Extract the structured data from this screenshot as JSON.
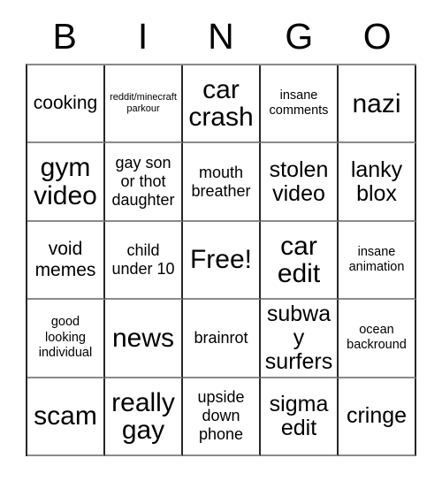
{
  "card": {
    "header_letters": [
      "B",
      "I",
      "N",
      "G",
      "O"
    ],
    "rows": [
      [
        {
          "text": "cooking",
          "size": "lg"
        },
        {
          "text": "reddit/minecraft parkour",
          "size": "xs"
        },
        {
          "text": "car crash",
          "size": "xxl"
        },
        {
          "text": "insane comments",
          "size": "sm"
        },
        {
          "text": "nazi",
          "size": "xxl"
        }
      ],
      [
        {
          "text": "gym video",
          "size": "xxl"
        },
        {
          "text": "gay son or thot daughter",
          "size": "md"
        },
        {
          "text": "mouth breather",
          "size": "md"
        },
        {
          "text": "stolen video",
          "size": "xl"
        },
        {
          "text": "lanky blox",
          "size": "xl"
        }
      ],
      [
        {
          "text": "void memes",
          "size": "lg"
        },
        {
          "text": "child under 10",
          "size": "md"
        },
        {
          "text": "Free!",
          "size": "xxl"
        },
        {
          "text": "car edit",
          "size": "xxl"
        },
        {
          "text": "insane animation",
          "size": "sm"
        }
      ],
      [
        {
          "text": "good looking individual",
          "size": "sm"
        },
        {
          "text": "news",
          "size": "xxl"
        },
        {
          "text": "brainrot",
          "size": "md"
        },
        {
          "text": "subway surfers",
          "size": "xl"
        },
        {
          "text": "ocean backround",
          "size": "sm"
        }
      ],
      [
        {
          "text": "scam",
          "size": "xxl"
        },
        {
          "text": "really gay",
          "size": "xxl"
        },
        {
          "text": "upside down phone",
          "size": "md"
        },
        {
          "text": "sigma edit",
          "size": "xl"
        },
        {
          "text": "cringe",
          "size": "xl"
        }
      ]
    ]
  },
  "colors": {
    "background": "#ffffff",
    "text": "#000000",
    "border_dark": "#262626",
    "border_light": "#8a8a8a"
  }
}
